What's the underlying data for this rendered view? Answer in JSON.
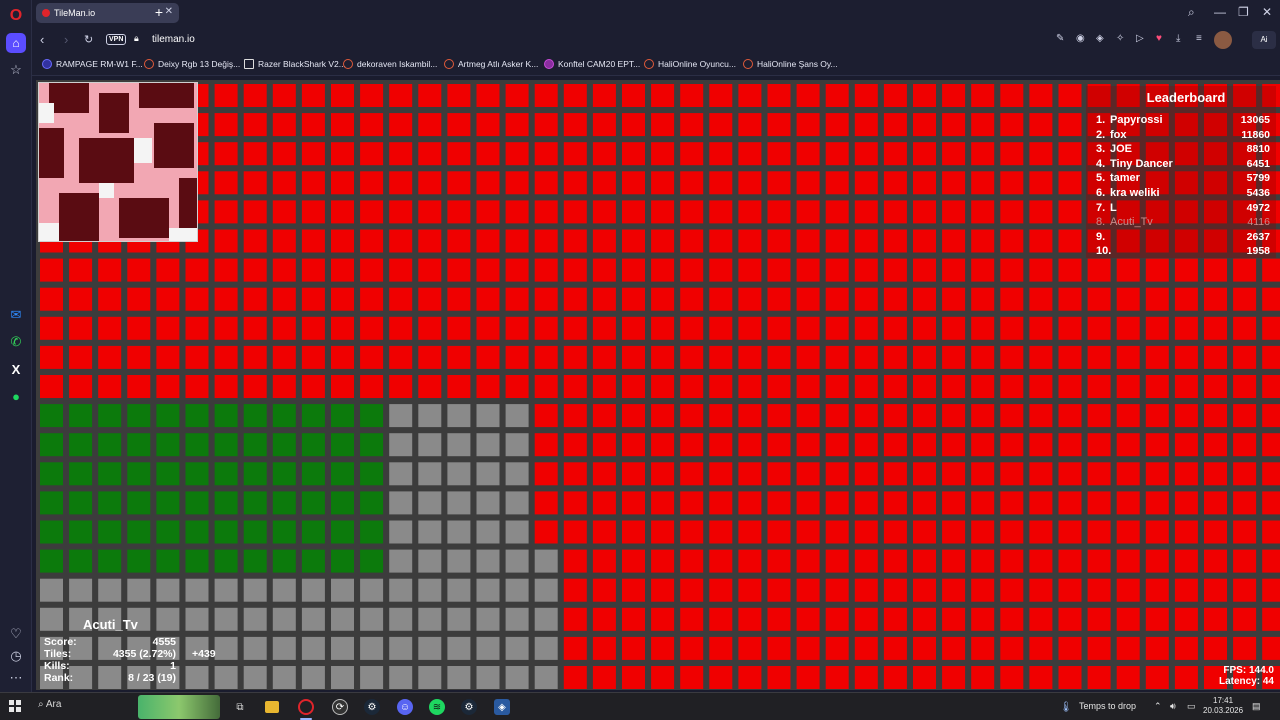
{
  "browser": {
    "tab_title": "TileMan.io",
    "url": "tileman.io",
    "vpn_badge": "VPN",
    "ai_button": "Ai",
    "bookmarks": [
      "RAMPAGE RM-W1 F...",
      "Deixy Rgb 13 Değiş...",
      "Razer BlackShark V2...",
      "dekoraven Iskambil...",
      "Artmeg Atlı Asker K...",
      "Konftel CAM20 EPT...",
      "HaliOnline Oyuncu...",
      "HaliOnline Şans Oy..."
    ]
  },
  "game": {
    "colors": {
      "enemy": "#f00000",
      "enemy_line": "#d00000",
      "own": "#0c7a0c",
      "neutral": "#8a8a8a",
      "grid": "#3c3c3c"
    },
    "leaderboard": {
      "title": "Leaderboard",
      "rows": [
        {
          "rank": "1.",
          "name": "Papyrossi",
          "score": "13065"
        },
        {
          "rank": "2.",
          "name": "fox",
          "score": "11860"
        },
        {
          "rank": "3.",
          "name": "JOE",
          "score": "8810"
        },
        {
          "rank": "4.",
          "name": "Tiny Dancer",
          "score": "6451"
        },
        {
          "rank": "5.",
          "name": "tamer",
          "score": "5799"
        },
        {
          "rank": "6.",
          "name": "kra weliki",
          "score": "5436"
        },
        {
          "rank": "7.",
          "name": "L",
          "score": "4972"
        },
        {
          "rank": "8.",
          "name": "Acuti_Tv",
          "score": "4116"
        },
        {
          "rank": "9.",
          "name": "",
          "score": "2637"
        },
        {
          "rank": "10.",
          "name": "",
          "score": "1958"
        }
      ]
    },
    "player": {
      "name": "Acuti_Tv",
      "score_label": "Score:",
      "score": "4555",
      "tiles_label": "Tiles:",
      "tiles": "4355 (2.72%)",
      "tiles_delta": "+439",
      "kills_label": "Kills:",
      "kills": "1",
      "rank_label": "Rank:",
      "rank": "8 / 23 (19)"
    },
    "stats": {
      "fps_label": "FPS:",
      "fps": "144.0",
      "latency_label": "Latency:",
      "latency": "44"
    }
  },
  "taskbar": {
    "search_placeholder": "Ara",
    "weather_text": "Temps to drop",
    "time": "17:41",
    "date": "20.03.2026"
  }
}
